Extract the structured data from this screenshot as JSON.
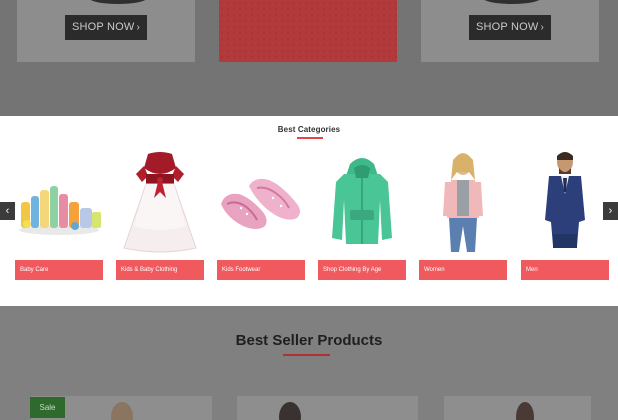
{
  "top_banner": {
    "promos": [
      {
        "button_label": "SHOP NOW",
        "chevron": "›"
      },
      {
        "button_label": "SHOP NOW",
        "chevron": "›"
      }
    ]
  },
  "categories": {
    "title": "Best Categories",
    "prev_arrow": "‹",
    "next_arrow": "›",
    "items": [
      {
        "label": "Baby Care",
        "icon": "baby-care-products-image"
      },
      {
        "label": "Kids & Baby Clothing",
        "icon": "girls-dress-image"
      },
      {
        "label": "Kids Footwear",
        "icon": "pink-shoes-image"
      },
      {
        "label": "Shop Clothing By Age",
        "icon": "green-hoodie-image"
      },
      {
        "label": "Women",
        "icon": "woman-model-image"
      },
      {
        "label": "Men",
        "icon": "man-model-image"
      }
    ]
  },
  "best_seller": {
    "title": "Best Seller Products",
    "sale_badge": "Sale"
  },
  "colors": {
    "accent": "#f05a5f",
    "overlay": "#7b7b7b",
    "sale_green": "#2e6a2c"
  }
}
